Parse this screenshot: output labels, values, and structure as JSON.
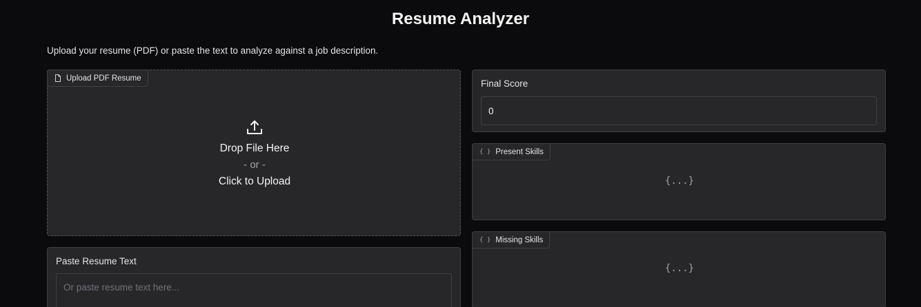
{
  "header": {
    "title": "Resume Analyzer",
    "description": "Upload your resume (PDF) or paste the text to analyze against a job description."
  },
  "upload": {
    "label": "Upload PDF Resume",
    "icon": "file-icon",
    "drop_text": "Drop File Here",
    "or_text": "- or -",
    "click_text": "Click to Upload"
  },
  "paste": {
    "label": "Paste Resume Text",
    "placeholder": "Or paste resume text here..."
  },
  "score": {
    "label": "Final Score",
    "value": "0"
  },
  "present_skills": {
    "label": "Present Skills",
    "icon": "json-braces-icon",
    "empty_glyph": "{...}"
  },
  "missing_skills": {
    "label": "Missing Skills",
    "icon": "json-braces-icon",
    "empty_glyph": "{...}"
  },
  "colors": {
    "background": "#0b0b0d",
    "panel": "#27272a",
    "border": "#3f3f46",
    "text": "#f4f4f5",
    "muted": "#a1a1aa"
  }
}
